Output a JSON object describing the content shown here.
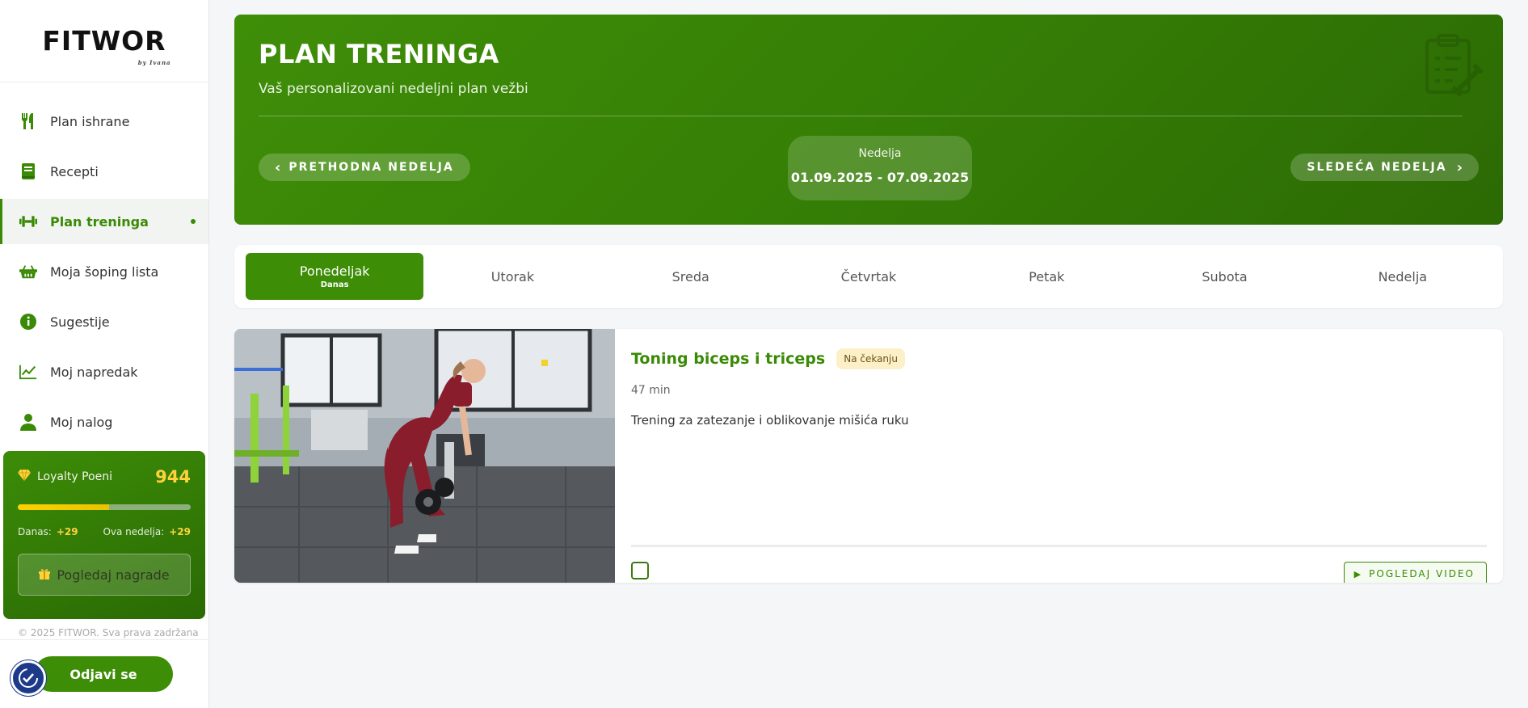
{
  "brand": {
    "logo": "FITWOR",
    "logo_sub": "by Ivana"
  },
  "sidebar": {
    "items": [
      {
        "label": "Plan ishrane",
        "icon": "utensils-icon"
      },
      {
        "label": "Recepti",
        "icon": "book-icon"
      },
      {
        "label": "Plan treninga",
        "icon": "dumbbell-icon",
        "active": true
      },
      {
        "label": "Moja šoping lista",
        "icon": "basket-icon"
      },
      {
        "label": "Sugestije",
        "icon": "info-icon"
      },
      {
        "label": "Moj napredak",
        "icon": "chart-line-icon"
      },
      {
        "label": "Moj nalog",
        "icon": "user-icon"
      }
    ],
    "loyalty": {
      "title": "Loyalty Poeni",
      "points": "944",
      "progress": 0.53,
      "today_label": "Danas:",
      "today_value": "+29",
      "week_label": "Ova nedelja:",
      "week_value": "+29",
      "rewards_button": "Pogledaj nagrade"
    },
    "copyright": "© 2025 FITWOR. Sva prava zadržana",
    "logout": "Odjavi se"
  },
  "hero": {
    "title": "PLAN TRENINGA",
    "subtitle": "Vaš personalizovani nedeljni plan vežbi",
    "prev_week": "PRETHODNA NEDELJA",
    "next_week": "SLEDEĆA NEDELJA",
    "week_label": "Nedelja",
    "week_range": "01.09.2025 - 07.09.2025"
  },
  "days": [
    {
      "label": "Ponedeljak",
      "sub": "Danas",
      "active": true
    },
    {
      "label": "Utorak"
    },
    {
      "label": "Sreda"
    },
    {
      "label": "Četvrtak"
    },
    {
      "label": "Petak"
    },
    {
      "label": "Subota"
    },
    {
      "label": "Nedelja"
    }
  ],
  "workout": {
    "title": "Toning biceps i triceps",
    "status": "Na čekanju",
    "duration": "47 min",
    "description": "Trening za zatezanje i oblikovanje mišića ruku",
    "video_button": "POGLEDAJ VIDEO"
  },
  "colors": {
    "accent": "#3d8d06",
    "gold": "#ffd23c",
    "badge_bg": "#fdf0c8"
  }
}
